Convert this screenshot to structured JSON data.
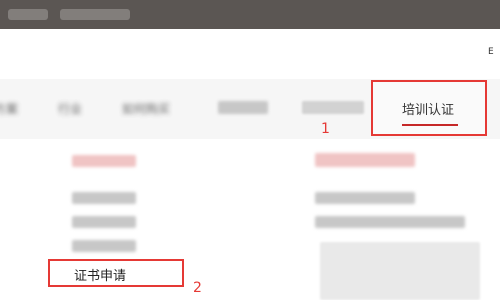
{
  "header": {
    "lang_label": "E"
  },
  "nav": {
    "items": [
      "方案",
      "行业",
      "如何购买"
    ],
    "active_label": "培训认证"
  },
  "dropdown": {
    "highlighted_item": "证书申请"
  },
  "annotations": {
    "step1": "1",
    "step2": "2"
  },
  "colors": {
    "highlight_box": "#e53935",
    "topbar": "#5b5653",
    "active_underline": "#c62828"
  }
}
